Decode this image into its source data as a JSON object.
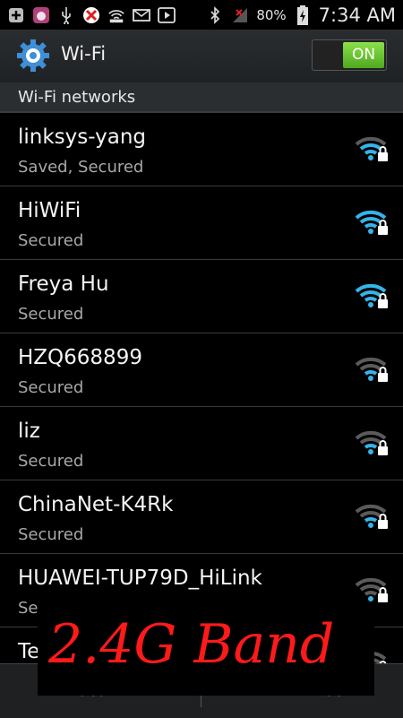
{
  "statusbar": {
    "battery_percent": "80%",
    "time": "7:34 AM",
    "left_icons": [
      "add-icon",
      "app-icon",
      "usb-icon",
      "blocked-icon",
      "wifi50-icon",
      "mail-icon",
      "play-icon"
    ],
    "right_icons": [
      "bluetooth-icon",
      "no-signal-icon",
      "battery-charging-icon"
    ]
  },
  "header": {
    "title": "Wi-Fi",
    "toggle_label": "ON",
    "accent": "#5fbf2a"
  },
  "section": {
    "label": "Wi-Fi networks"
  },
  "networks": [
    {
      "ssid": "linksys-yang",
      "status": "Saved, Secured",
      "strength": 3,
      "secured": true,
      "signal_color": "#35b4e8"
    },
    {
      "ssid": "HiWiFi",
      "status": "Secured",
      "strength": 4,
      "secured": true,
      "signal_color": "#35b4e8"
    },
    {
      "ssid": "Freya Hu",
      "status": "Secured",
      "strength": 4,
      "secured": true,
      "signal_color": "#35b4e8"
    },
    {
      "ssid": "HZQ668899",
      "status": "Secured",
      "strength": 2,
      "secured": true,
      "signal_color": "#35b4e8"
    },
    {
      "ssid": "liz",
      "status": "Secured",
      "strength": 2,
      "secured": true,
      "signal_color": "#35b4e8"
    },
    {
      "ssid": "ChinaNet-K4Rk",
      "status": "Secured",
      "strength": 2,
      "secured": true,
      "signal_color": "#35b4e8"
    },
    {
      "ssid": "HUAWEI-TUP79D_HiLink",
      "status": "Se",
      "strength": 1,
      "secured": true,
      "signal_color": "#35b4e8"
    },
    {
      "ssid": "Te",
      "status": "",
      "strength": 1,
      "secured": true,
      "signal_color": "#35b4e8"
    }
  ],
  "bottombar": {
    "left_label": "Scan",
    "right_label": "Wi-Fi Direct"
  },
  "overlay": {
    "label": "2.4G Band",
    "color": "#ff1a1a"
  }
}
